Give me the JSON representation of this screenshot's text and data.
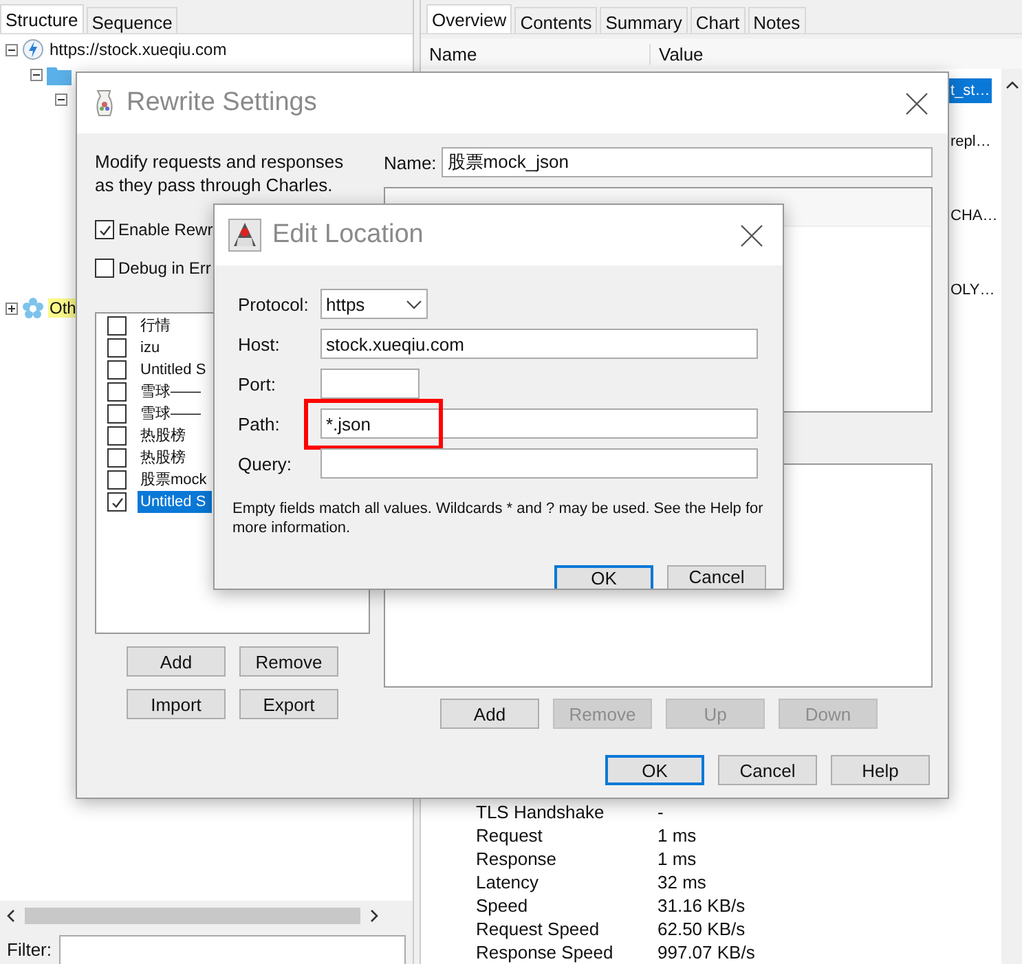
{
  "main_window": {
    "left_tabs": [
      {
        "label": "Structure",
        "selected": true
      },
      {
        "label": "Sequence",
        "selected": false
      }
    ],
    "tree": [
      {
        "kind": "host",
        "label": "https://stock.xueqiu.com",
        "expanded": true,
        "highlighted": false,
        "children": [
          {
            "kind": "folder",
            "expanded": true,
            "children": [
              {
                "expanded": true
              }
            ]
          }
        ]
      },
      {
        "kind": "other",
        "label": "Oth",
        "expanded": false,
        "highlighted": true
      }
    ],
    "filter": {
      "label": "Filter:"
    },
    "right_tabs": [
      {
        "label": "Overview",
        "selected": true
      },
      {
        "label": "Contents",
        "selected": false
      },
      {
        "label": "Summary",
        "selected": false
      },
      {
        "label": "Chart",
        "selected": false
      },
      {
        "label": "Notes",
        "selected": false
      }
    ],
    "table": {
      "columns": [
        "Name",
        "Value"
      ],
      "value_fragments": [
        {
          "value": "t_st…",
          "selected": true
        },
        {
          "value": "repl…",
          "selected": false
        },
        {
          "value": "CHA…",
          "selected": false
        },
        {
          "value": "OLY…",
          "selected": false
        }
      ],
      "rows": [
        {
          "name": "TLS Handshake",
          "value": "-"
        },
        {
          "name": "Request",
          "value": "1 ms"
        },
        {
          "name": "Response",
          "value": "1 ms"
        },
        {
          "name": "Latency",
          "value": "32 ms"
        },
        {
          "name": "Speed",
          "value": "31.16 KB/s"
        },
        {
          "name": "Request Speed",
          "value": "62.50 KB/s"
        },
        {
          "name": "Response Speed",
          "value": "997.07 KB/s"
        }
      ]
    }
  },
  "rewrite_settings": {
    "title": "Rewrite Settings",
    "description": "Modify requests and responses as they pass through Charles.",
    "options": [
      {
        "label": "Enable Rewr",
        "checked": true
      },
      {
        "label": "Debug in Err",
        "checked": false
      }
    ],
    "sets": [
      {
        "label": "行情",
        "checked": false,
        "selected": false
      },
      {
        "label": "izu",
        "checked": false,
        "selected": false
      },
      {
        "label": "Untitled S",
        "checked": false,
        "selected": false
      },
      {
        "label": "雪球——",
        "checked": false,
        "selected": false
      },
      {
        "label": "雪球——",
        "checked": false,
        "selected": false
      },
      {
        "label": "热股榜",
        "checked": false,
        "selected": false
      },
      {
        "label": "热股榜",
        "checked": false,
        "selected": false
      },
      {
        "label": "股票mock",
        "checked": false,
        "selected": false
      },
      {
        "label": "Untitled S",
        "checked": true,
        "selected": true
      }
    ],
    "set_buttons": [
      "Add",
      "Remove",
      "Import",
      "Export"
    ],
    "name_label": "Name:",
    "name_value": "股票mock_json",
    "rule_buttons": [
      {
        "label": "Add",
        "disabled": false
      },
      {
        "label": "Remove",
        "disabled": true
      },
      {
        "label": "Up",
        "disabled": true
      },
      {
        "label": "Down",
        "disabled": true
      }
    ],
    "dialog_buttons": [
      {
        "label": "OK",
        "default": true
      },
      {
        "label": "Cancel",
        "default": false
      },
      {
        "label": "Help",
        "default": false
      }
    ]
  },
  "edit_location": {
    "title": "Edit Location",
    "fields": [
      {
        "kind": "select",
        "label": "Protocol:",
        "value": "https",
        "highlighted": false
      },
      {
        "kind": "text",
        "label": "Host:",
        "value": "stock.xueqiu.com",
        "highlighted": false
      },
      {
        "kind": "short",
        "label": "Port:",
        "highlighted": false
      },
      {
        "kind": "text",
        "label": "Path:",
        "value": "*.json",
        "highlighted": true
      },
      {
        "kind": "text",
        "label": "Query:",
        "highlighted": false
      }
    ],
    "note": "Empty fields match all values. Wildcards * and ? may be used. See the Help for more information.",
    "buttons": [
      {
        "label": "OK",
        "default": true
      },
      {
        "label": "Cancel",
        "default": false
      }
    ]
  }
}
